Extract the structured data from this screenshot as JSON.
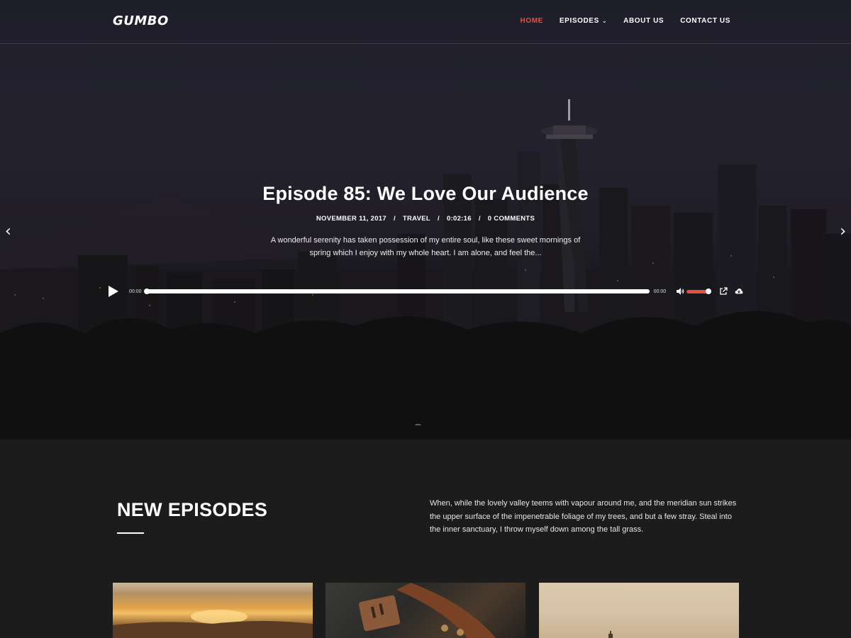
{
  "header": {
    "logo": "GUMBO",
    "nav": [
      {
        "label": "HOME",
        "active": true
      },
      {
        "label": "EPISODES",
        "has_dropdown": true
      },
      {
        "label": "ABOUT US"
      },
      {
        "label": "CONTACT US"
      }
    ]
  },
  "hero": {
    "title": "Episode 85: We Love Our Audience",
    "meta": {
      "date": "NOVEMBER 11, 2017",
      "category": "TRAVEL",
      "duration": "0:02:16",
      "comments": "0 COMMENTS",
      "separator": "/"
    },
    "excerpt": "A wonderful serenity has taken possession of my entire soul, like these sweet mornings of spring which I enjoy with my whole heart. I am alone, and feel the...",
    "prev_arrow_icon": "chevron-left-icon",
    "next_arrow_icon": "chevron-right-icon"
  },
  "player": {
    "current_time": "00:00",
    "total_time": "00:00",
    "progress": 0,
    "volume": 1.0,
    "accent_color": "#e8503c"
  },
  "section": {
    "title": "NEW EPISODES",
    "description": "When, while the lovely valley teems with vapour around me, and the meridian sun strikes the upper surface of the impenetrable foliage of my trees, and but a few stray. Steal into the inner sanctuary, I throw myself down among the tall grass."
  },
  "colors": {
    "accent": "#e8503c",
    "section_bg": "#1c1c1c"
  }
}
